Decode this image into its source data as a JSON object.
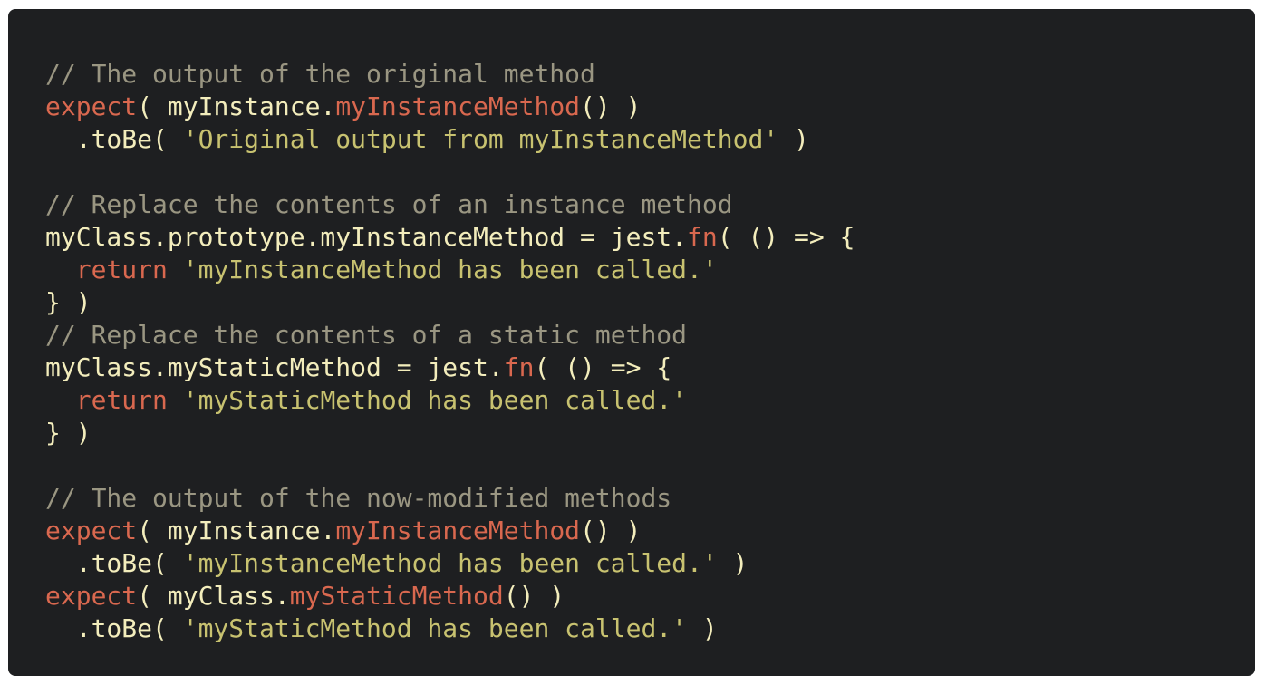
{
  "editor": {
    "background": "#1e1f21",
    "colors": {
      "comment": "#9a9682",
      "keyword": "#d9684f",
      "function": "#d9684f",
      "string": "#c8c270",
      "plain": "#f3edbc"
    },
    "lines": [
      [
        {
          "t": "comment",
          "v": "// The output of the original method"
        }
      ],
      [
        {
          "t": "kw",
          "v": "expect"
        },
        {
          "t": "plain",
          "v": "( myInstance."
        },
        {
          "t": "fn",
          "v": "myInstanceMethod"
        },
        {
          "t": "plain",
          "v": "() )"
        }
      ],
      [
        {
          "t": "plain",
          "v": "  .toBe( "
        },
        {
          "t": "string",
          "v": "'Original output from myInstanceMethod'"
        },
        {
          "t": "plain",
          "v": " )"
        }
      ],
      [
        {
          "t": "plain",
          "v": ""
        }
      ],
      [
        {
          "t": "comment",
          "v": "// Replace the contents of an instance method"
        }
      ],
      [
        {
          "t": "plain",
          "v": "myClass.prototype.myInstanceMethod = jest."
        },
        {
          "t": "fn",
          "v": "fn"
        },
        {
          "t": "plain",
          "v": "( () => {"
        }
      ],
      [
        {
          "t": "plain",
          "v": "  "
        },
        {
          "t": "kw",
          "v": "return"
        },
        {
          "t": "plain",
          "v": " "
        },
        {
          "t": "string",
          "v": "'myInstanceMethod has been called.'"
        }
      ],
      [
        {
          "t": "plain",
          "v": "} )"
        }
      ],
      [
        {
          "t": "comment",
          "v": "// Replace the contents of a static method"
        }
      ],
      [
        {
          "t": "plain",
          "v": "myClass.myStaticMethod = jest."
        },
        {
          "t": "fn",
          "v": "fn"
        },
        {
          "t": "plain",
          "v": "( () => {"
        }
      ],
      [
        {
          "t": "plain",
          "v": "  "
        },
        {
          "t": "kw",
          "v": "return"
        },
        {
          "t": "plain",
          "v": " "
        },
        {
          "t": "string",
          "v": "'myStaticMethod has been called.'"
        }
      ],
      [
        {
          "t": "plain",
          "v": "} )"
        }
      ],
      [
        {
          "t": "plain",
          "v": ""
        }
      ],
      [
        {
          "t": "comment",
          "v": "// The output of the now-modified methods"
        }
      ],
      [
        {
          "t": "kw",
          "v": "expect"
        },
        {
          "t": "plain",
          "v": "( myInstance."
        },
        {
          "t": "fn",
          "v": "myInstanceMethod"
        },
        {
          "t": "plain",
          "v": "() )"
        }
      ],
      [
        {
          "t": "plain",
          "v": "  .toBe( "
        },
        {
          "t": "string",
          "v": "'myInstanceMethod has been called.'"
        },
        {
          "t": "plain",
          "v": " )"
        }
      ],
      [
        {
          "t": "kw",
          "v": "expect"
        },
        {
          "t": "plain",
          "v": "( myClass."
        },
        {
          "t": "fn",
          "v": "myStaticMethod"
        },
        {
          "t": "plain",
          "v": "() )"
        }
      ],
      [
        {
          "t": "plain",
          "v": "  .toBe( "
        },
        {
          "t": "string",
          "v": "'myStaticMethod has been called.'"
        },
        {
          "t": "plain",
          "v": " )"
        }
      ]
    ]
  }
}
